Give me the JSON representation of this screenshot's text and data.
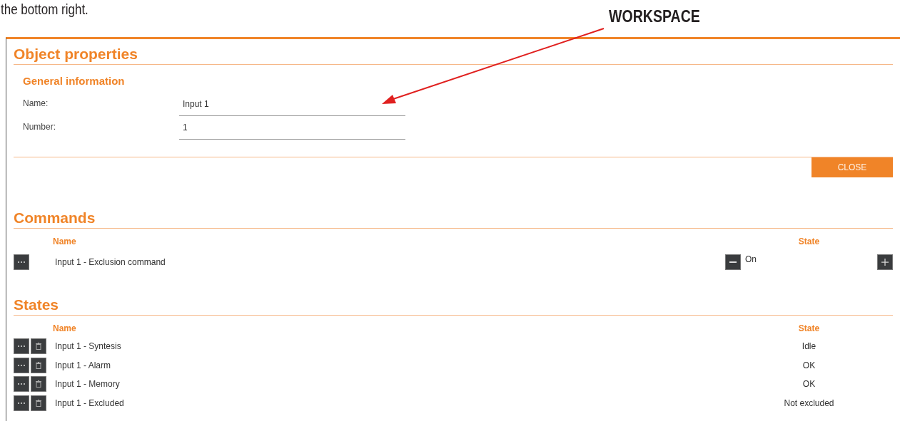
{
  "caption": "the bottom right.",
  "annotation": {
    "label": "WORKSPACE"
  },
  "panel": {
    "title": "Object properties",
    "general": {
      "title": "General information",
      "fields": [
        {
          "label": "Name:",
          "value": "Input 1"
        },
        {
          "label": "Number:",
          "value": "1"
        }
      ]
    },
    "close_button": "CLOSE",
    "commands": {
      "title": "Commands",
      "columns": [
        "Name",
        "State"
      ],
      "rows": [
        {
          "name": "Input 1 - Exclusion command",
          "state": "On"
        }
      ]
    },
    "states": {
      "title": "States",
      "columns": [
        "Name",
        "State"
      ],
      "rows": [
        {
          "name": "Input 1 - Syntesis",
          "state": "Idle"
        },
        {
          "name": "Input 1 - Alarm",
          "state": "OK"
        },
        {
          "name": "Input 1 - Memory",
          "state": "OK"
        },
        {
          "name": "Input 1 - Excluded",
          "state": "Not excluded"
        }
      ]
    }
  }
}
